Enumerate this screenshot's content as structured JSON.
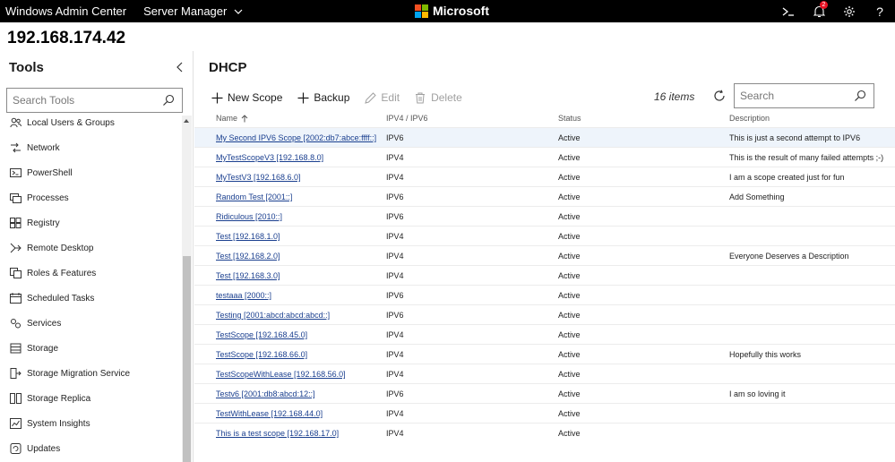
{
  "topbar": {
    "app_title": "Windows Admin Center",
    "context_menu": "Server Manager",
    "brand": "Microsoft",
    "notification_count": "2"
  },
  "server": {
    "name": "192.168.174.42"
  },
  "sidebar": {
    "title": "Tools",
    "search_placeholder": "Search Tools",
    "items": [
      {
        "label": "Local Users & Groups",
        "icon": "users-icon"
      },
      {
        "label": "Network",
        "icon": "network-icon"
      },
      {
        "label": "PowerShell",
        "icon": "powershell-icon"
      },
      {
        "label": "Processes",
        "icon": "processes-icon"
      },
      {
        "label": "Registry",
        "icon": "registry-icon"
      },
      {
        "label": "Remote Desktop",
        "icon": "remote-desktop-icon"
      },
      {
        "label": "Roles & Features",
        "icon": "roles-icon"
      },
      {
        "label": "Scheduled Tasks",
        "icon": "scheduled-tasks-icon"
      },
      {
        "label": "Services",
        "icon": "services-icon"
      },
      {
        "label": "Storage",
        "icon": "storage-icon"
      },
      {
        "label": "Storage Migration Service",
        "icon": "storage-migration-icon"
      },
      {
        "label": "Storage Replica",
        "icon": "storage-replica-icon"
      },
      {
        "label": "System Insights",
        "icon": "system-insights-icon"
      },
      {
        "label": "Updates",
        "icon": "updates-icon"
      }
    ]
  },
  "main": {
    "title": "DHCP",
    "toolbar": {
      "new_scope": "New Scope",
      "backup": "Backup",
      "edit": "Edit",
      "delete": "Delete"
    },
    "items_count": "16 items",
    "search_placeholder": "Search",
    "columns": {
      "name": "Name",
      "ip": "IPV4 / IPV6",
      "status": "Status",
      "description": "Description"
    },
    "rows": [
      {
        "name": "My Second IPV6 Scope [2002:db7:abce:ffff::]",
        "ip": "IPV6",
        "status": "Active",
        "description": "This is just a second attempt to IPV6"
      },
      {
        "name": "MyTestScopeV3 [192.168.8.0]",
        "ip": "IPV4",
        "status": "Active",
        "description": "This is the result of many failed attempts ;-)"
      },
      {
        "name": "MyTestV3 [192.168.6.0]",
        "ip": "IPV4",
        "status": "Active",
        "description": "I am a scope created just for fun"
      },
      {
        "name": "Random Test [2001::]",
        "ip": "IPV6",
        "status": "Active",
        "description": "Add Something"
      },
      {
        "name": "Ridiculous [2010::]",
        "ip": "IPV6",
        "status": "Active",
        "description": ""
      },
      {
        "name": "Test [192.168.1.0]",
        "ip": "IPV4",
        "status": "Active",
        "description": ""
      },
      {
        "name": "Test [192.168.2.0]",
        "ip": "IPV4",
        "status": "Active",
        "description": "Everyone Deserves a Description"
      },
      {
        "name": "Test [192.168.3.0]",
        "ip": "IPV4",
        "status": "Active",
        "description": ""
      },
      {
        "name": "testaaa [2000::]",
        "ip": "IPV6",
        "status": "Active",
        "description": ""
      },
      {
        "name": "Testing [2001:abcd:abcd:abcd::]",
        "ip": "IPV6",
        "status": "Active",
        "description": ""
      },
      {
        "name": "TestScope [192.168.45.0]",
        "ip": "IPV4",
        "status": "Active",
        "description": ""
      },
      {
        "name": "TestScope [192.168.66.0]",
        "ip": "IPV4",
        "status": "Active",
        "description": "Hopefully this works"
      },
      {
        "name": "TestScopeWithLease [192.168.56.0]",
        "ip": "IPV4",
        "status": "Active",
        "description": ""
      },
      {
        "name": "Testv6 [2001:db8:abcd:12::]",
        "ip": "IPV6",
        "status": "Active",
        "description": "I am so loving it"
      },
      {
        "name": "TestWithLease [192.168.44.0]",
        "ip": "IPV4",
        "status": "Active",
        "description": ""
      },
      {
        "name": "This is a test scope [192.168.17.0]",
        "ip": "IPV4",
        "status": "Active",
        "description": ""
      }
    ]
  },
  "colors": {
    "ms_red": "#f25022",
    "ms_green": "#7fba00",
    "ms_blue": "#00a4ef",
    "ms_yellow": "#ffb900",
    "link": "#1a3f8f",
    "selected_row": "#eef4fb",
    "badge": "#e81123"
  }
}
